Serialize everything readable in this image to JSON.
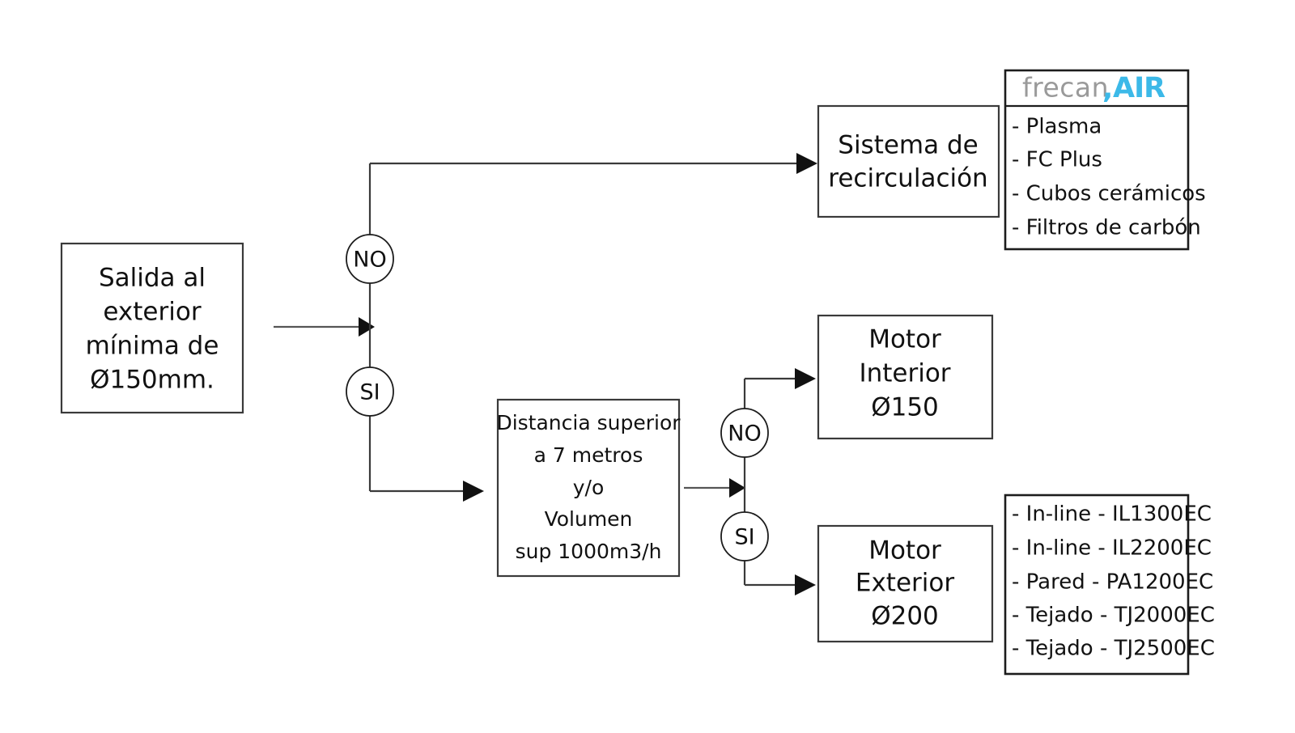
{
  "diagram": {
    "title": "Esquema de seleccion de sistema de extraccion",
    "type": "flowchart",
    "background_color": "#ffffff",
    "line_color": "#3a3a3a",
    "accent_color": "#3cb9e8",
    "logo_gray": "#9a9a9a"
  },
  "nodes": {
    "start": {
      "name": "salida-exterior",
      "lines": [
        "Salida al",
        "exterior",
        "mínima de",
        "Ø150mm."
      ]
    },
    "recirculation": {
      "name": "sistema-recirculacion",
      "lines": [
        "Sistema de",
        "recirculación"
      ]
    },
    "distance": {
      "name": "distancia-volumen",
      "lines": [
        "Distancia  superior",
        "a 7 metros",
        "y/o",
        "Volumen",
        "sup 1000m3/h"
      ]
    },
    "motor_interior": {
      "name": "motor-interior",
      "lines": [
        "Motor",
        "Interior",
        "Ø150"
      ]
    },
    "motor_exterior": {
      "name": "motor-exterior",
      "lines": [
        "Motor",
        "Exterior",
        "Ø200"
      ]
    }
  },
  "decisions": {
    "first_no": "NO",
    "first_si": "SI",
    "second_no": "NO",
    "second_si": "SI"
  },
  "panels": {
    "recirculation_products": {
      "name": "panel-productos-recirculacion",
      "logo": {
        "brand": "frecan",
        "comma": ",",
        "suffix": "AIR"
      },
      "items": [
        "- Plasma",
        "- FC Plus",
        "- Cubos cerámicos",
        "- Filtros de carbón"
      ]
    },
    "exterior_products": {
      "name": "panel-productos-exterior",
      "items": [
        "- In-line - IL1300EC",
        "- In-line - IL2200EC",
        "- Pared - PA1200EC",
        "- Tejado - TJ2000EC",
        "- Tejado - TJ2500EC"
      ]
    }
  }
}
